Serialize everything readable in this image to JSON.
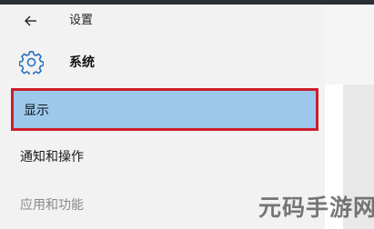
{
  "header": {
    "back_icon": "back-arrow-icon",
    "title": "设置"
  },
  "section": {
    "icon": "gear-icon",
    "title": "系统"
  },
  "nav": {
    "items": [
      {
        "label": "显示",
        "selected": true
      },
      {
        "label": "通知和操作",
        "selected": false
      },
      {
        "label": "应用和功能",
        "selected": false
      }
    ]
  },
  "watermark": "元码手游网",
  "colors": {
    "selected_bg": "#9cc8ec",
    "highlight_border": "#cc1f29",
    "accent_icon": "#1e6fc2",
    "sidebar_bg": "#f2f2f2"
  }
}
